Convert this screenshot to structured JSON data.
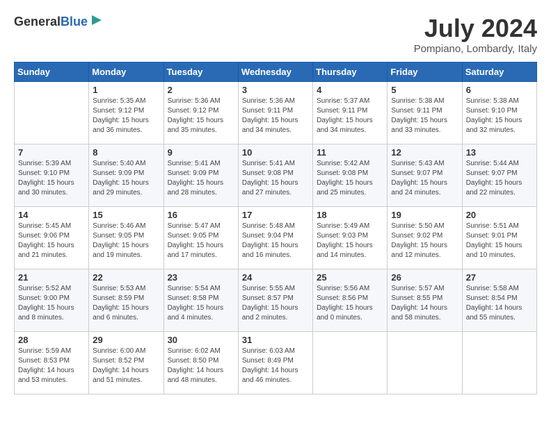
{
  "header": {
    "logo_general": "General",
    "logo_blue": "Blue",
    "month_year": "July 2024",
    "location": "Pompiano, Lombardy, Italy"
  },
  "days_of_week": [
    "Sunday",
    "Monday",
    "Tuesday",
    "Wednesday",
    "Thursday",
    "Friday",
    "Saturday"
  ],
  "weeks": [
    [
      {
        "day": "",
        "info": ""
      },
      {
        "day": "1",
        "info": "Sunrise: 5:35 AM\nSunset: 9:12 PM\nDaylight: 15 hours\nand 36 minutes."
      },
      {
        "day": "2",
        "info": "Sunrise: 5:36 AM\nSunset: 9:12 PM\nDaylight: 15 hours\nand 35 minutes."
      },
      {
        "day": "3",
        "info": "Sunrise: 5:36 AM\nSunset: 9:11 PM\nDaylight: 15 hours\nand 34 minutes."
      },
      {
        "day": "4",
        "info": "Sunrise: 5:37 AM\nSunset: 9:11 PM\nDaylight: 15 hours\nand 34 minutes."
      },
      {
        "day": "5",
        "info": "Sunrise: 5:38 AM\nSunset: 9:11 PM\nDaylight: 15 hours\nand 33 minutes."
      },
      {
        "day": "6",
        "info": "Sunrise: 5:38 AM\nSunset: 9:10 PM\nDaylight: 15 hours\nand 32 minutes."
      }
    ],
    [
      {
        "day": "7",
        "info": "Sunrise: 5:39 AM\nSunset: 9:10 PM\nDaylight: 15 hours\nand 30 minutes."
      },
      {
        "day": "8",
        "info": "Sunrise: 5:40 AM\nSunset: 9:09 PM\nDaylight: 15 hours\nand 29 minutes."
      },
      {
        "day": "9",
        "info": "Sunrise: 5:41 AM\nSunset: 9:09 PM\nDaylight: 15 hours\nand 28 minutes."
      },
      {
        "day": "10",
        "info": "Sunrise: 5:41 AM\nSunset: 9:08 PM\nDaylight: 15 hours\nand 27 minutes."
      },
      {
        "day": "11",
        "info": "Sunrise: 5:42 AM\nSunset: 9:08 PM\nDaylight: 15 hours\nand 25 minutes."
      },
      {
        "day": "12",
        "info": "Sunrise: 5:43 AM\nSunset: 9:07 PM\nDaylight: 15 hours\nand 24 minutes."
      },
      {
        "day": "13",
        "info": "Sunrise: 5:44 AM\nSunset: 9:07 PM\nDaylight: 15 hours\nand 22 minutes."
      }
    ],
    [
      {
        "day": "14",
        "info": "Sunrise: 5:45 AM\nSunset: 9:06 PM\nDaylight: 15 hours\nand 21 minutes."
      },
      {
        "day": "15",
        "info": "Sunrise: 5:46 AM\nSunset: 9:05 PM\nDaylight: 15 hours\nand 19 minutes."
      },
      {
        "day": "16",
        "info": "Sunrise: 5:47 AM\nSunset: 9:05 PM\nDaylight: 15 hours\nand 17 minutes."
      },
      {
        "day": "17",
        "info": "Sunrise: 5:48 AM\nSunset: 9:04 PM\nDaylight: 15 hours\nand 16 minutes."
      },
      {
        "day": "18",
        "info": "Sunrise: 5:49 AM\nSunset: 9:03 PM\nDaylight: 15 hours\nand 14 minutes."
      },
      {
        "day": "19",
        "info": "Sunrise: 5:50 AM\nSunset: 9:02 PM\nDaylight: 15 hours\nand 12 minutes."
      },
      {
        "day": "20",
        "info": "Sunrise: 5:51 AM\nSunset: 9:01 PM\nDaylight: 15 hours\nand 10 minutes."
      }
    ],
    [
      {
        "day": "21",
        "info": "Sunrise: 5:52 AM\nSunset: 9:00 PM\nDaylight: 15 hours\nand 8 minutes."
      },
      {
        "day": "22",
        "info": "Sunrise: 5:53 AM\nSunset: 8:59 PM\nDaylight: 15 hours\nand 6 minutes."
      },
      {
        "day": "23",
        "info": "Sunrise: 5:54 AM\nSunset: 8:58 PM\nDaylight: 15 hours\nand 4 minutes."
      },
      {
        "day": "24",
        "info": "Sunrise: 5:55 AM\nSunset: 8:57 PM\nDaylight: 15 hours\nand 2 minutes."
      },
      {
        "day": "25",
        "info": "Sunrise: 5:56 AM\nSunset: 8:56 PM\nDaylight: 15 hours\nand 0 minutes."
      },
      {
        "day": "26",
        "info": "Sunrise: 5:57 AM\nSunset: 8:55 PM\nDaylight: 14 hours\nand 58 minutes."
      },
      {
        "day": "27",
        "info": "Sunrise: 5:58 AM\nSunset: 8:54 PM\nDaylight: 14 hours\nand 55 minutes."
      }
    ],
    [
      {
        "day": "28",
        "info": "Sunrise: 5:59 AM\nSunset: 8:53 PM\nDaylight: 14 hours\nand 53 minutes."
      },
      {
        "day": "29",
        "info": "Sunrise: 6:00 AM\nSunset: 8:52 PM\nDaylight: 14 hours\nand 51 minutes."
      },
      {
        "day": "30",
        "info": "Sunrise: 6:02 AM\nSunset: 8:50 PM\nDaylight: 14 hours\nand 48 minutes."
      },
      {
        "day": "31",
        "info": "Sunrise: 6:03 AM\nSunset: 8:49 PM\nDaylight: 14 hours\nand 46 minutes."
      },
      {
        "day": "",
        "info": ""
      },
      {
        "day": "",
        "info": ""
      },
      {
        "day": "",
        "info": ""
      }
    ]
  ]
}
